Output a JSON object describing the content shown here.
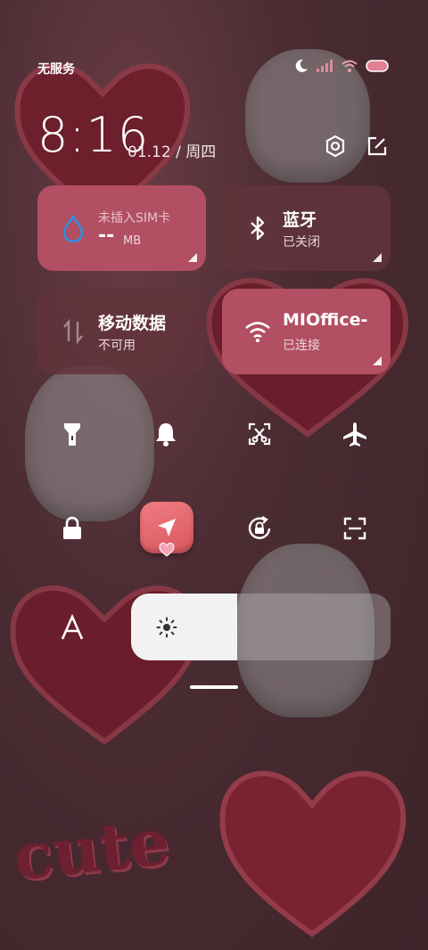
{
  "status": {
    "carrier": "无服务"
  },
  "header": {
    "time": "8:16",
    "date": "01.12 / 周四"
  },
  "tiles": {
    "data_usage": {
      "title": "未插入SIM卡",
      "value": "--",
      "unit": "MB"
    },
    "bluetooth": {
      "title": "蓝牙",
      "subtitle": "已关闭"
    },
    "mobile_data": {
      "title": "移动数据",
      "subtitle": "不可用"
    },
    "wifi": {
      "title": "MIOffice-",
      "subtitle": "已连接"
    }
  },
  "brightness": {
    "level": 0.41
  },
  "wallpaper": {
    "text": "cute"
  },
  "colors": {
    "accent": "#b24f62",
    "tile_off": "#62343c",
    "background": "#4a2c33"
  }
}
